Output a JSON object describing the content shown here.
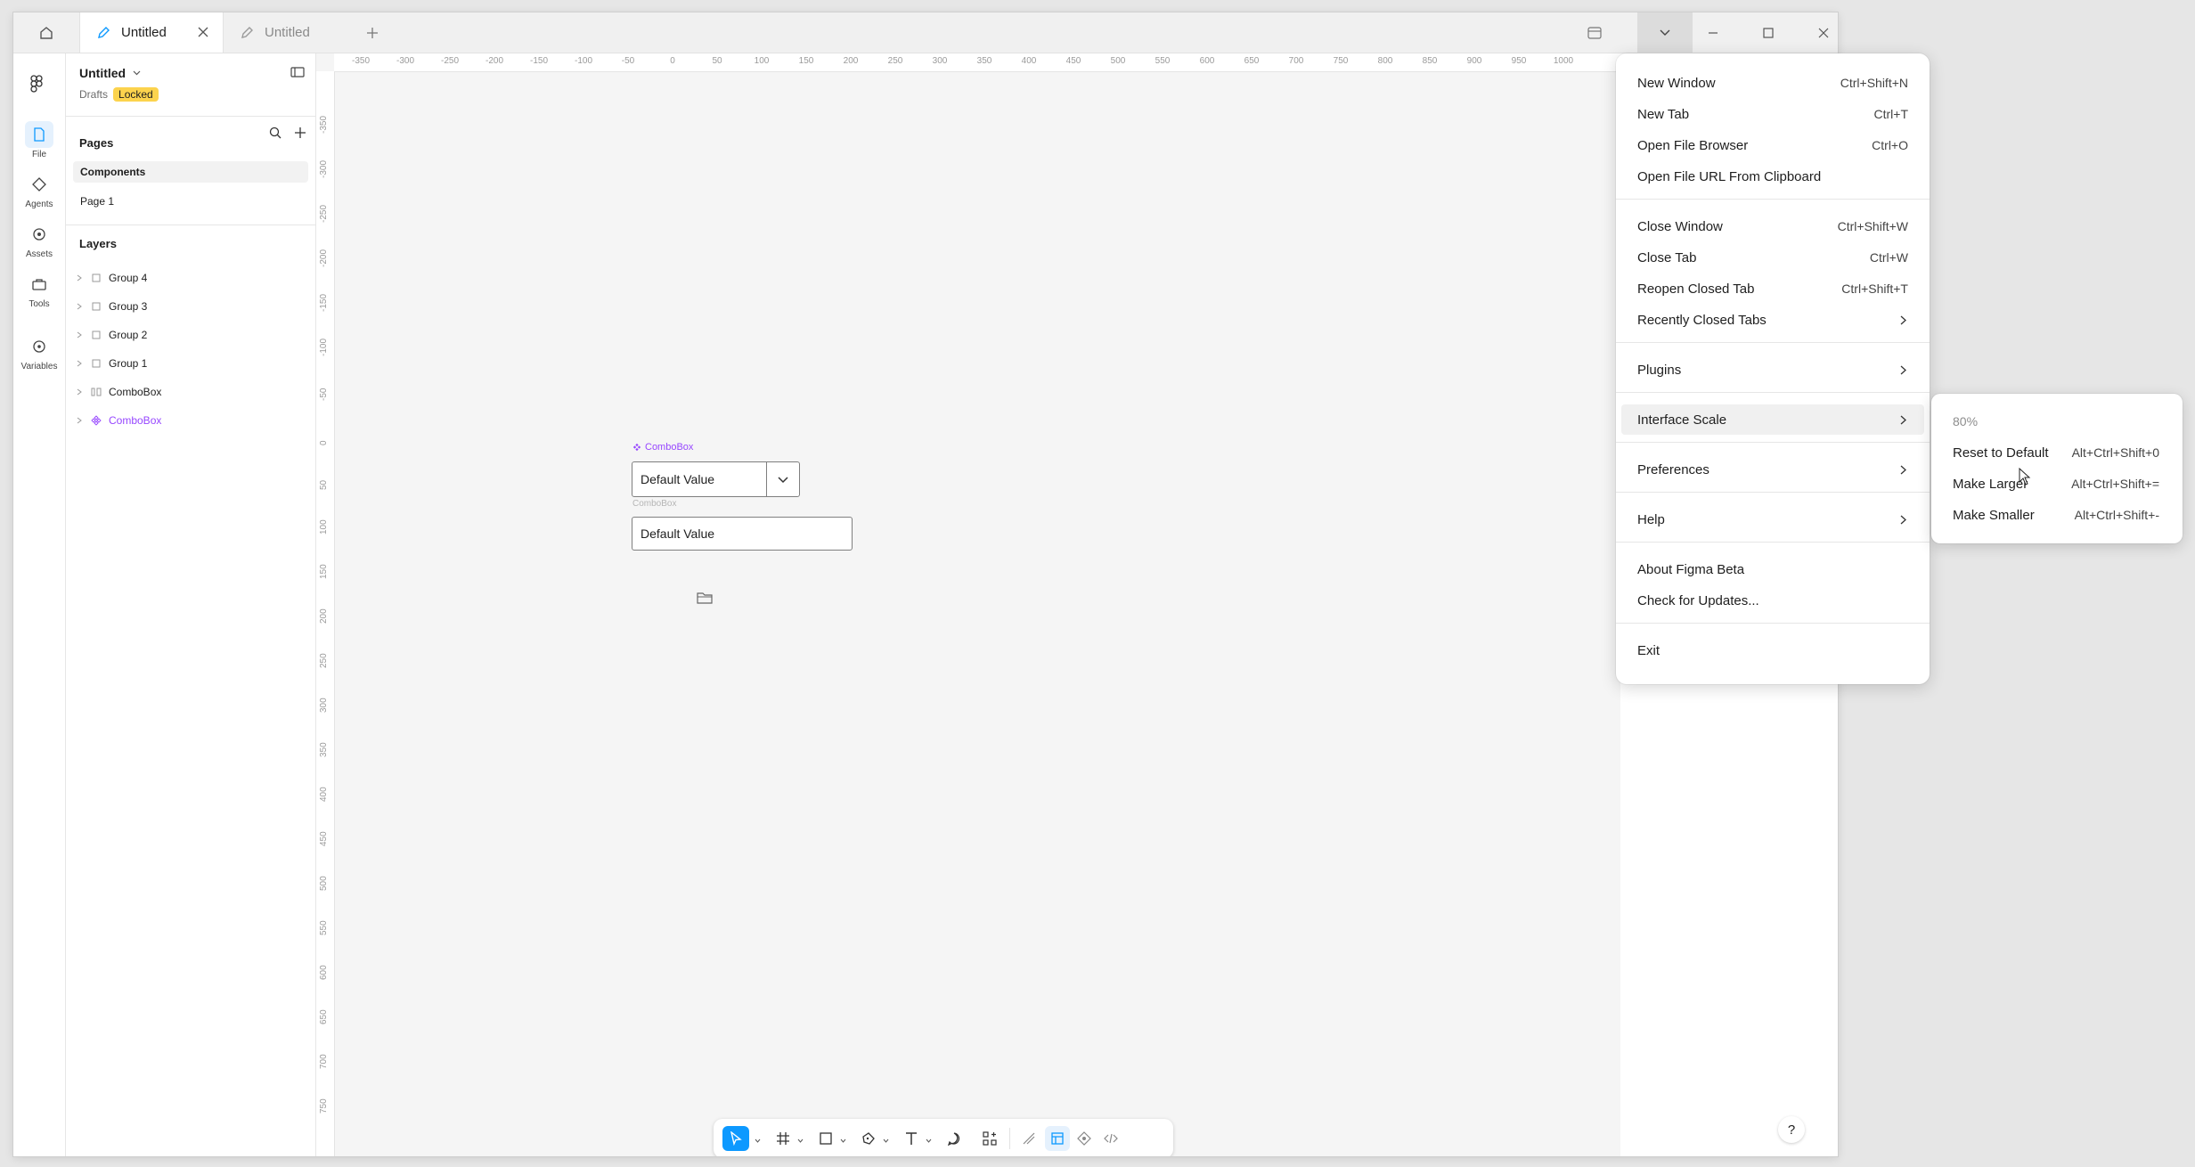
{
  "tabs": [
    {
      "label": "Untitled",
      "active": true
    },
    {
      "label": "Untitled",
      "active": false
    }
  ],
  "rail": [
    {
      "label": "File",
      "icon": "file-icon",
      "active": true
    },
    {
      "label": "Agents",
      "icon": "agents-icon",
      "active": false
    },
    {
      "label": "Assets",
      "icon": "assets-icon",
      "active": false
    },
    {
      "label": "Tools",
      "icon": "tools-icon",
      "active": false
    },
    {
      "label": "Variables",
      "icon": "variables-icon",
      "active": false
    }
  ],
  "file": {
    "title": "Untitled",
    "location": "Drafts",
    "badge": "Locked"
  },
  "pages": {
    "heading": "Pages",
    "items": [
      {
        "label": "Components",
        "selected": true
      },
      {
        "label": "Page 1",
        "selected": false
      }
    ]
  },
  "layers": {
    "heading": "Layers",
    "items": [
      {
        "label": "Group 4",
        "icon": "frame-icon",
        "color": "default"
      },
      {
        "label": "Group 3",
        "icon": "frame-icon",
        "color": "default"
      },
      {
        "label": "Group 2",
        "icon": "frame-icon",
        "color": "default"
      },
      {
        "label": "Group 1",
        "icon": "frame-icon",
        "color": "default"
      },
      {
        "label": "ComboBox",
        "icon": "autolayout-icon",
        "color": "default"
      },
      {
        "label": "ComboBox",
        "icon": "component-icon",
        "color": "purple"
      }
    ]
  },
  "ruler": {
    "top": [
      "-350",
      "-300",
      "-250",
      "-200",
      "-150",
      "-100",
      "-50",
      "0",
      "50",
      "100",
      "150",
      "200",
      "250",
      "300",
      "350",
      "400",
      "450",
      "500",
      "550",
      "600",
      "650",
      "700",
      "750",
      "800",
      "850",
      "900",
      "950",
      "1000"
    ],
    "left": [
      "-350",
      "-300",
      "-250",
      "-200",
      "-150",
      "-100",
      "-50",
      "0",
      "50",
      "100",
      "150",
      "200",
      "250",
      "300",
      "350",
      "400",
      "450",
      "500",
      "550",
      "600",
      "650",
      "700",
      "750"
    ]
  },
  "canvas": {
    "component_label": "ComboBox",
    "combo1_value": "Default Value",
    "combo_sub_label": "ComboBox",
    "combo2_value": "Default Value"
  },
  "help": "?",
  "menu": {
    "items": [
      {
        "label": "New Window",
        "shortcut": "Ctrl+Shift+N"
      },
      {
        "label": "New Tab",
        "shortcut": "Ctrl+T"
      },
      {
        "label": "Open File Browser",
        "shortcut": "Ctrl+O"
      },
      {
        "label": "Open File URL From Clipboard",
        "shortcut": ""
      },
      {
        "label": "Close Window",
        "shortcut": "Ctrl+Shift+W"
      },
      {
        "label": "Close Tab",
        "shortcut": "Ctrl+W"
      },
      {
        "label": "Reopen Closed Tab",
        "shortcut": "Ctrl+Shift+T"
      },
      {
        "label": "Recently Closed Tabs",
        "submenu": true
      },
      {
        "label": "Plugins",
        "submenu": true
      },
      {
        "label": "Interface Scale",
        "submenu": true,
        "hover": true
      },
      {
        "label": "Preferences",
        "submenu": true
      },
      {
        "label": "Help",
        "submenu": true
      },
      {
        "label": "About Figma Beta",
        "shortcut": ""
      },
      {
        "label": "Check for Updates...",
        "shortcut": ""
      },
      {
        "label": "Exit",
        "shortcut": ""
      }
    ]
  },
  "submenu": {
    "current": "80%",
    "items": [
      {
        "label": "Reset to Default",
        "shortcut": "Alt+Ctrl+Shift+0"
      },
      {
        "label": "Make Larger",
        "shortcut": "Alt+Ctrl+Shift+="
      },
      {
        "label": "Make Smaller",
        "shortcut": "Alt+Ctrl+Shift+-"
      }
    ]
  },
  "colors": {
    "accent": "#0d99ff",
    "component": "#9747ff",
    "badge": "#fcd34d"
  }
}
